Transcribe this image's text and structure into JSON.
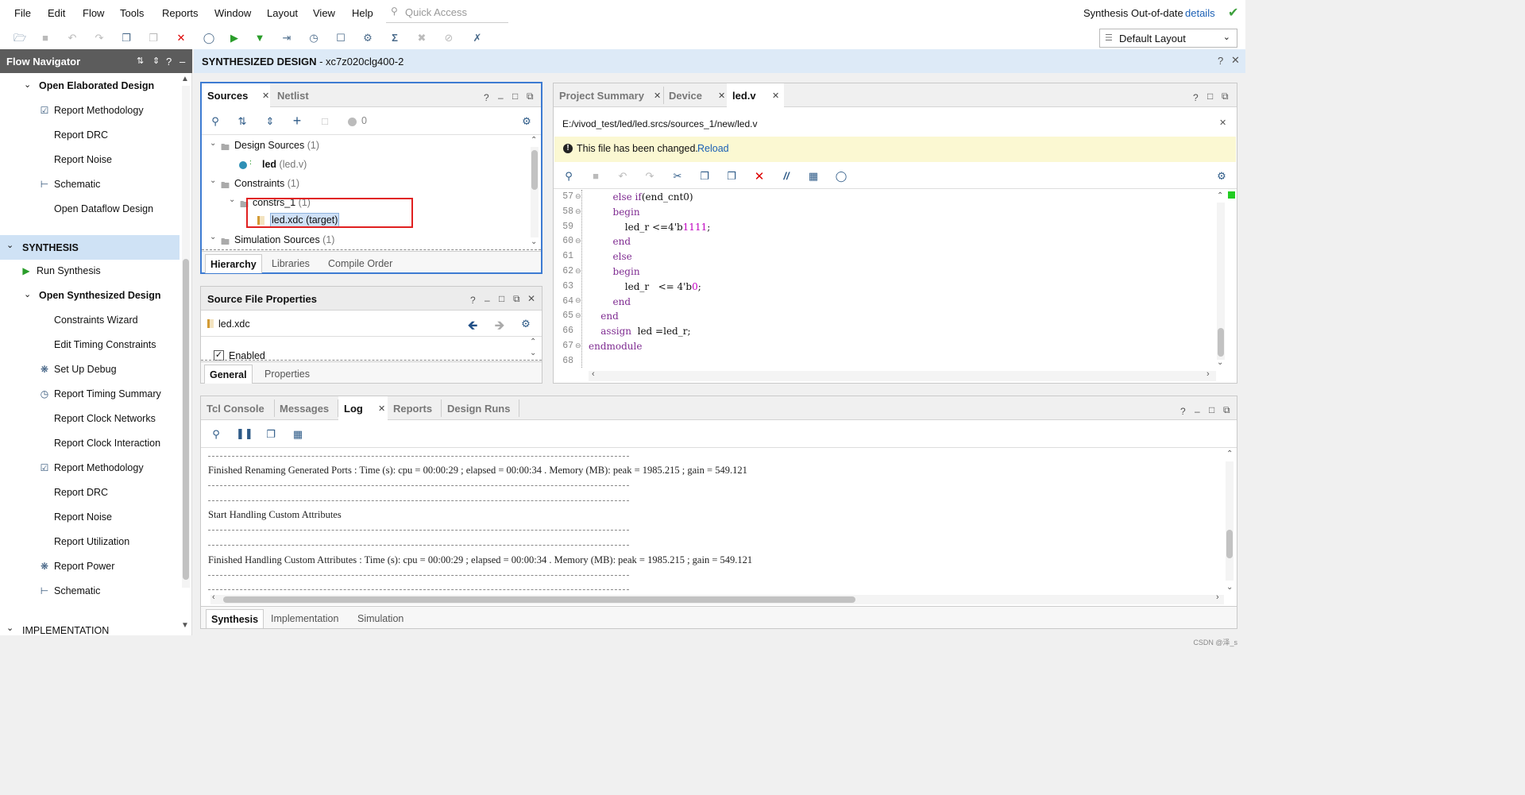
{
  "menubar": {
    "items": [
      "File",
      "Edit",
      "Flow",
      "Tools",
      "Reports",
      "Window",
      "Layout",
      "View",
      "Help"
    ],
    "quick_access_placeholder": "Quick Access",
    "status_text": "Synthesis Out-of-date",
    "details_link": "details"
  },
  "toolbar": {
    "layout_select": "Default Layout"
  },
  "flow_navigator": {
    "title": "Flow Navigator",
    "items": [
      {
        "label": "Open Elaborated Design",
        "bold": true
      },
      {
        "label": "Report Methodology"
      },
      {
        "label": "Report DRC"
      },
      {
        "label": "Report Noise"
      },
      {
        "label": "Schematic"
      },
      {
        "label": "Open Dataflow Design"
      },
      {
        "label": "SYNTHESIS",
        "bold": true
      },
      {
        "label": "Run Synthesis"
      },
      {
        "label": "Open Synthesized Design",
        "bold": true
      },
      {
        "label": "Constraints Wizard"
      },
      {
        "label": "Edit Timing Constraints"
      },
      {
        "label": "Set Up Debug"
      },
      {
        "label": "Report Timing Summary"
      },
      {
        "label": "Report Clock Networks"
      },
      {
        "label": "Report Clock Interaction"
      },
      {
        "label": "Report Methodology"
      },
      {
        "label": "Report DRC"
      },
      {
        "label": "Report Noise"
      },
      {
        "label": "Report Utilization"
      },
      {
        "label": "Report Power"
      },
      {
        "label": "Schematic"
      },
      {
        "label": "IMPLEMENTATION",
        "bold": true
      }
    ]
  },
  "design_header": {
    "title": "SYNTHESIZED DESIGN",
    "part": " - xc7z020clg400-2"
  },
  "sources": {
    "tabs": [
      "Sources",
      "Netlist"
    ],
    "count_badge": "0",
    "tree": {
      "design_sources": "Design Sources",
      "design_sources_count": " (1)",
      "led_module": "led",
      "led_file": " (led.v)",
      "constraints": "Constraints",
      "constraints_count": " (1)",
      "constrs": "constrs_1",
      "constrs_count": " (1)",
      "xdc": "led.xdc (target)",
      "sim_sources": "Simulation Sources",
      "sim_count": " (1)"
    },
    "bottom_tabs": [
      "Hierarchy",
      "Libraries",
      "Compile Order"
    ]
  },
  "source_props": {
    "title": "Source File Properties",
    "file": "led.xdc",
    "enabled_label": "Enabled",
    "enabled": true,
    "bottom_tabs": [
      "General",
      "Properties"
    ]
  },
  "editor": {
    "tabs": [
      "Project Summary",
      "Device",
      "led.v"
    ],
    "path": "E:/vivod_test/led/led.srcs/sources_1/new/led.v",
    "banner_text": "This file has been changed.",
    "banner_link": "Reload",
    "line_numbers": [
      "57",
      "58",
      "59",
      "60",
      "61",
      "62",
      "63",
      "64",
      "65",
      "66",
      "67",
      "68"
    ]
  },
  "log_panel": {
    "tabs": [
      "Tcl Console",
      "Messages",
      "Log",
      "Reports",
      "Design Runs"
    ],
    "lines": [
      "Finished Renaming Generated Ports : Time (s): cpu = 00:00:29 ; elapsed = 00:00:34 . Memory (MB): peak = 1985.215 ; gain = 549.121",
      "Start Handling Custom Attributes",
      "Finished Handling Custom Attributes : Time (s): cpu = 00:00:29 ; elapsed = 00:00:34 . Memory (MB): peak = 1985.215 ; gain = 549.121"
    ],
    "bottom_tabs": [
      "Synthesis",
      "Implementation",
      "Simulation"
    ]
  },
  "watermark": "CSDN @泽_s"
}
